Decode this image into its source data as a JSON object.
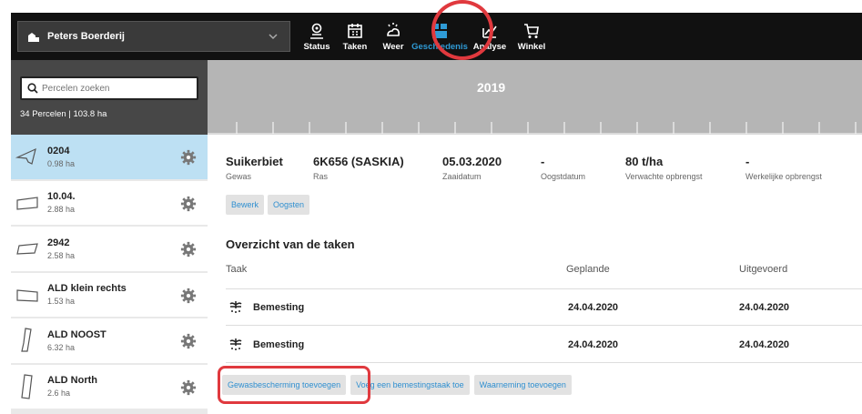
{
  "farm": {
    "name": "Peters Boerderij"
  },
  "nav": {
    "items": [
      {
        "label": "Status",
        "icon": "status-icon"
      },
      {
        "label": "Taken",
        "icon": "calendar-icon"
      },
      {
        "label": "Weer",
        "icon": "weather-icon"
      },
      {
        "label": "Geschiedenis",
        "icon": "history-icon"
      },
      {
        "label": "Analyse",
        "icon": "analysis-icon"
      },
      {
        "label": "Winkel",
        "icon": "cart-icon"
      }
    ],
    "active": "Geschiedenis",
    "active_color": "#2f9bd6"
  },
  "sidebar": {
    "search_placeholder": "Percelen zoeken",
    "summary": "34 Percelen | 103.8 ha",
    "parcels": [
      {
        "name": "0204",
        "area": "0.98 ha",
        "selected": true
      },
      {
        "name": "10.04.",
        "area": "2.88 ha"
      },
      {
        "name": "2942",
        "area": "2.58 ha"
      },
      {
        "name": "ALD klein rechts",
        "area": "1.53 ha"
      },
      {
        "name": "ALD NOOST",
        "area": "6.32 ha"
      },
      {
        "name": "ALD North",
        "area": "2.6 ha"
      }
    ]
  },
  "timeline": {
    "year": "2019"
  },
  "crop": {
    "gewas": {
      "value": "Suikerbiet",
      "label": "Gewas"
    },
    "ras": {
      "value": "6K656 (SASKIA)",
      "label": "Ras"
    },
    "zaaidatum": {
      "value": "05.03.2020",
      "label": "Zaaidatum"
    },
    "oogstdatum": {
      "value": "-",
      "label": "Oogstdatum"
    },
    "verwachte": {
      "value": "80 t/ha",
      "label": "Verwachte opbrengst"
    },
    "werkelijke": {
      "value": "-",
      "label": "Werkelijke opbrengst"
    }
  },
  "crop_actions": {
    "edit": "Bewerk",
    "harvest": "Oogsten"
  },
  "tasks": {
    "title": "Overzicht van de taken",
    "headers": {
      "task": "Taak",
      "planned": "Geplande",
      "done": "Uitgevoerd"
    },
    "rows": [
      {
        "task": "Bemesting",
        "planned": "24.04.2020",
        "done": "24.04.2020"
      },
      {
        "task": "Bemesting",
        "planned": "24.04.2020",
        "done": "24.04.2020"
      }
    ]
  },
  "task_actions": {
    "crop_protection": "Gewasbescherming toevoegen",
    "fertilize": "Voeg een bemestingstaak toe",
    "observation": "Waarneming toevoegen"
  },
  "colors": {
    "accent": "#2f9bd6",
    "highlight": "#e0393e",
    "selected_row": "#bde0f3"
  }
}
